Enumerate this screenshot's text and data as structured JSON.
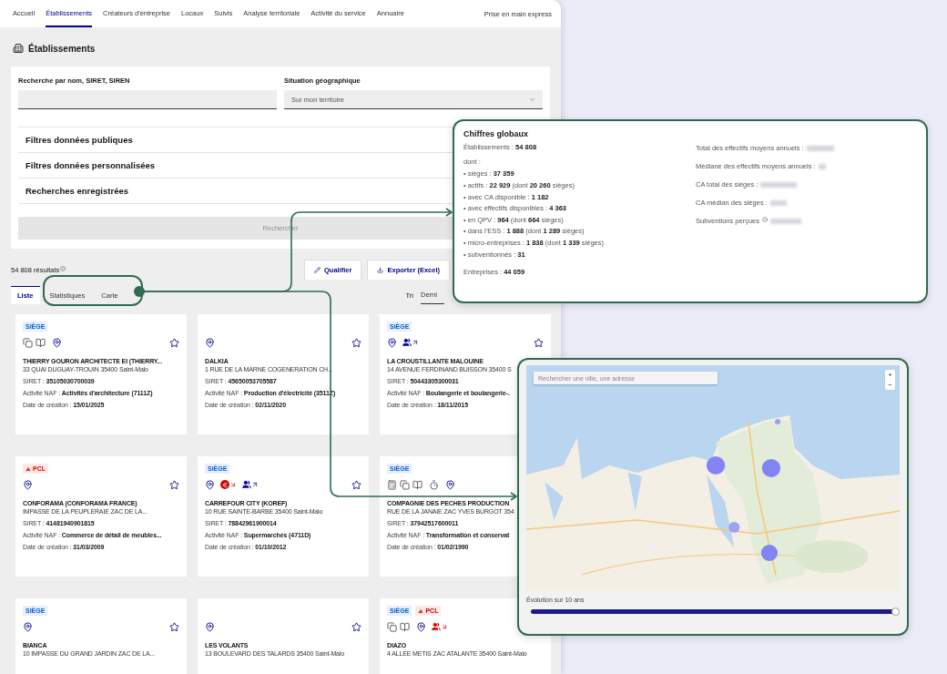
{
  "nav": {
    "items": [
      {
        "label": "Accueil",
        "selected": false
      },
      {
        "label": "Établissements",
        "selected": true
      },
      {
        "label": "Créateurs d'entreprise",
        "selected": false
      },
      {
        "label": "Locaux",
        "selected": false
      },
      {
        "label": "Suivis",
        "selected": false
      },
      {
        "label": "Analyse territoriale",
        "selected": false
      },
      {
        "label": "Activité du service",
        "selected": false
      },
      {
        "label": "Annuaire",
        "selected": false
      }
    ],
    "help_link": "Prise en main express"
  },
  "page_title": "Établissements",
  "search": {
    "name_label": "Recherche par nom, SIRET, SIREN",
    "geo_label": "Situation géographique",
    "geo_value": "Sur mon territoire",
    "filters": [
      "Filtres données publiques",
      "Filtres données personnalisées",
      "Recherches enregistrées"
    ],
    "submit": {
      "label": "Rechercher",
      "disabled": true
    }
  },
  "results": {
    "count": "54 808 résultats",
    "actions": [
      {
        "kind": "edit",
        "label": "Qualifier"
      },
      {
        "kind": "export",
        "label": "Exporter (Excel)"
      }
    ],
    "tabs": [
      {
        "label": "Liste",
        "selected": true
      },
      {
        "label": "Statistiques",
        "selected": false
      },
      {
        "label": "Carte",
        "selected": false
      }
    ],
    "sort_label": "Tri",
    "sort_value": "Derni"
  },
  "cards": [
    {
      "tags": [
        {
          "kind": "siege",
          "label": "SIÈGE"
        }
      ],
      "indicators": [
        {
          "kind": "copies"
        },
        {
          "kind": "book"
        },
        {
          "kind": "pin"
        }
      ],
      "favorite": false,
      "name": "THIERRY GOURON ARCHITECTE EI (THIERRY...",
      "address": "33 QUAI DUGUAY-TROUIN 35400 Saint-Malo",
      "lines": [
        "SIRET : **35105030700039**",
        "Activité NAF : **Activités d'architecture (7111Z)**",
        "Date de création : **15/01/2025**"
      ]
    },
    {
      "indicators": [
        {
          "kind": "pin"
        }
      ],
      "favorite": false,
      "name": "DALKIA",
      "address": "1 RUE DE LA MARNE COGENERATION CH...",
      "lines": [
        "SIRET : **45650053705587**",
        "Activité NAF : **Production d'électricité (3511Z)**",
        "Date de création : **02/11/2020**"
      ]
    },
    {
      "tags": [
        {
          "kind": "siege",
          "label": "SIÈGE"
        }
      ],
      "indicators": [
        {
          "kind": "pin"
        },
        {
          "kind": "staff-up"
        }
      ],
      "favorite": false,
      "name": "LA CROUSTILLANTE MALOUINE",
      "address": "14 AVENUE FERDINAND BUISSON 35400 S",
      "lines": [
        "SIRET : **50443305300031**",
        "Activité NAF : **Boulangerie et boulangerie-.**",
        "Date de création : **18/11/2015**"
      ]
    },
    {
      "tags": [
        {
          "kind": "pcl",
          "label": "PCL"
        }
      ],
      "indicators": [
        {
          "kind": "pin"
        }
      ],
      "favorite": false,
      "name": "CONFORAMA (CONFORAMA FRANCE)",
      "address": "IMPASSE DE LA PEUPLERAIE ZAC DE LA...",
      "lines": [
        "SIRET : **41481940901815**",
        "Activité NAF : **Commerce de détail de meubles...**",
        "Date de création : **31/03/2009**"
      ]
    },
    {
      "tags": [
        {
          "kind": "siege",
          "label": "SIÈGE"
        }
      ],
      "indicators": [
        {
          "kind": "pin"
        },
        {
          "kind": "revenue-down"
        },
        {
          "kind": "staff-up"
        }
      ],
      "favorite": false,
      "name": "CARREFOUR CITY (KOREF)",
      "address": "10 RUE SAINTE-BARBE 35400 Saint-Malo",
      "lines": [
        "SIRET : **78842961900014**",
        "Activité NAF : **Supermarchés (4711D)**",
        "Date de création : **01/10/2012**"
      ]
    },
    {
      "tags": [
        {
          "kind": "siege",
          "label": "SIÈGE"
        }
      ],
      "indicators": [
        {
          "kind": "calculator"
        },
        {
          "kind": "copies"
        },
        {
          "kind": "book"
        },
        {
          "kind": "timer"
        },
        {
          "kind": "pin"
        }
      ],
      "name": "COMPAGNIE DES PECHES PRODUCTION",
      "address": "RUE DE LA JANAIE ZAC YVES BURGOT 354",
      "lines": [
        "SIRET : **37942517600011**",
        "Activité NAF : **Transformation et conservat**",
        "Date de création : **01/02/1990**"
      ]
    },
    {
      "tags": [
        {
          "kind": "siege",
          "label": "SIÈGE"
        }
      ],
      "indicators": [
        {
          "kind": "pin"
        }
      ],
      "favorite": false,
      "name": "BIANCA",
      "address": "10 IMPASSE DU GRAND JARDIN ZAC DE LA..."
    },
    {
      "indicators": [
        {
          "kind": "pin"
        }
      ],
      "favorite": false,
      "name": "LES VOLANTS",
      "address": "13 BOULEVARD DES TALARDS 35400 Saint-Malo"
    },
    {
      "tags": [
        {
          "kind": "siege",
          "label": "SIÈGE"
        },
        {
          "kind": "pcl",
          "label": "PCL"
        }
      ],
      "indicators": [
        {
          "kind": "copies"
        },
        {
          "kind": "book"
        },
        {
          "kind": "pin"
        },
        {
          "kind": "staff-down"
        }
      ],
      "name": "DIAZO",
      "address": "4 ALLEE METIS ZAC ATALANTE 35400 Saint-Malo"
    }
  ],
  "stats_popup": {
    "title": "Chiffres globaux",
    "total": "Établissements : **54 808**",
    "intro": "dont :",
    "items": [
      "• sièges : **37 359**",
      "• actifs : **22 929** (dont **20 260** sièges)",
      "• avec CA disponible : **1 182**",
      "• avec effectifs disponibles : **4 363**",
      "• en QPV : **964** (dont **664** sièges)",
      "• dans l'ESS : **1 888** (dont **1 289** sièges)",
      "• micro-entreprises : **1 838** (dont **1 339** sièges)",
      "• subventionnés : **31**"
    ],
    "companies": "Entreprises : **44 059**",
    "right": [
      {
        "label": "Total des effectifs moyens annuels :",
        "info": false
      },
      {
        "label": "Médiane des effectifs moyens annuels :",
        "info": false
      },
      {
        "label": "CA total des sièges :",
        "info": false
      },
      {
        "label": "CA médian des sièges :",
        "info": false
      },
      {
        "label": "Subventions perçues",
        "info": true
      }
    ]
  },
  "map_popup": {
    "search_placeholder": "Rechercher une ville, une adresse",
    "zoom_in": "+",
    "zoom_out": "−",
    "timeline_label": "Évolution sur 10 ans",
    "timeline": {
      "level": 1
    }
  }
}
